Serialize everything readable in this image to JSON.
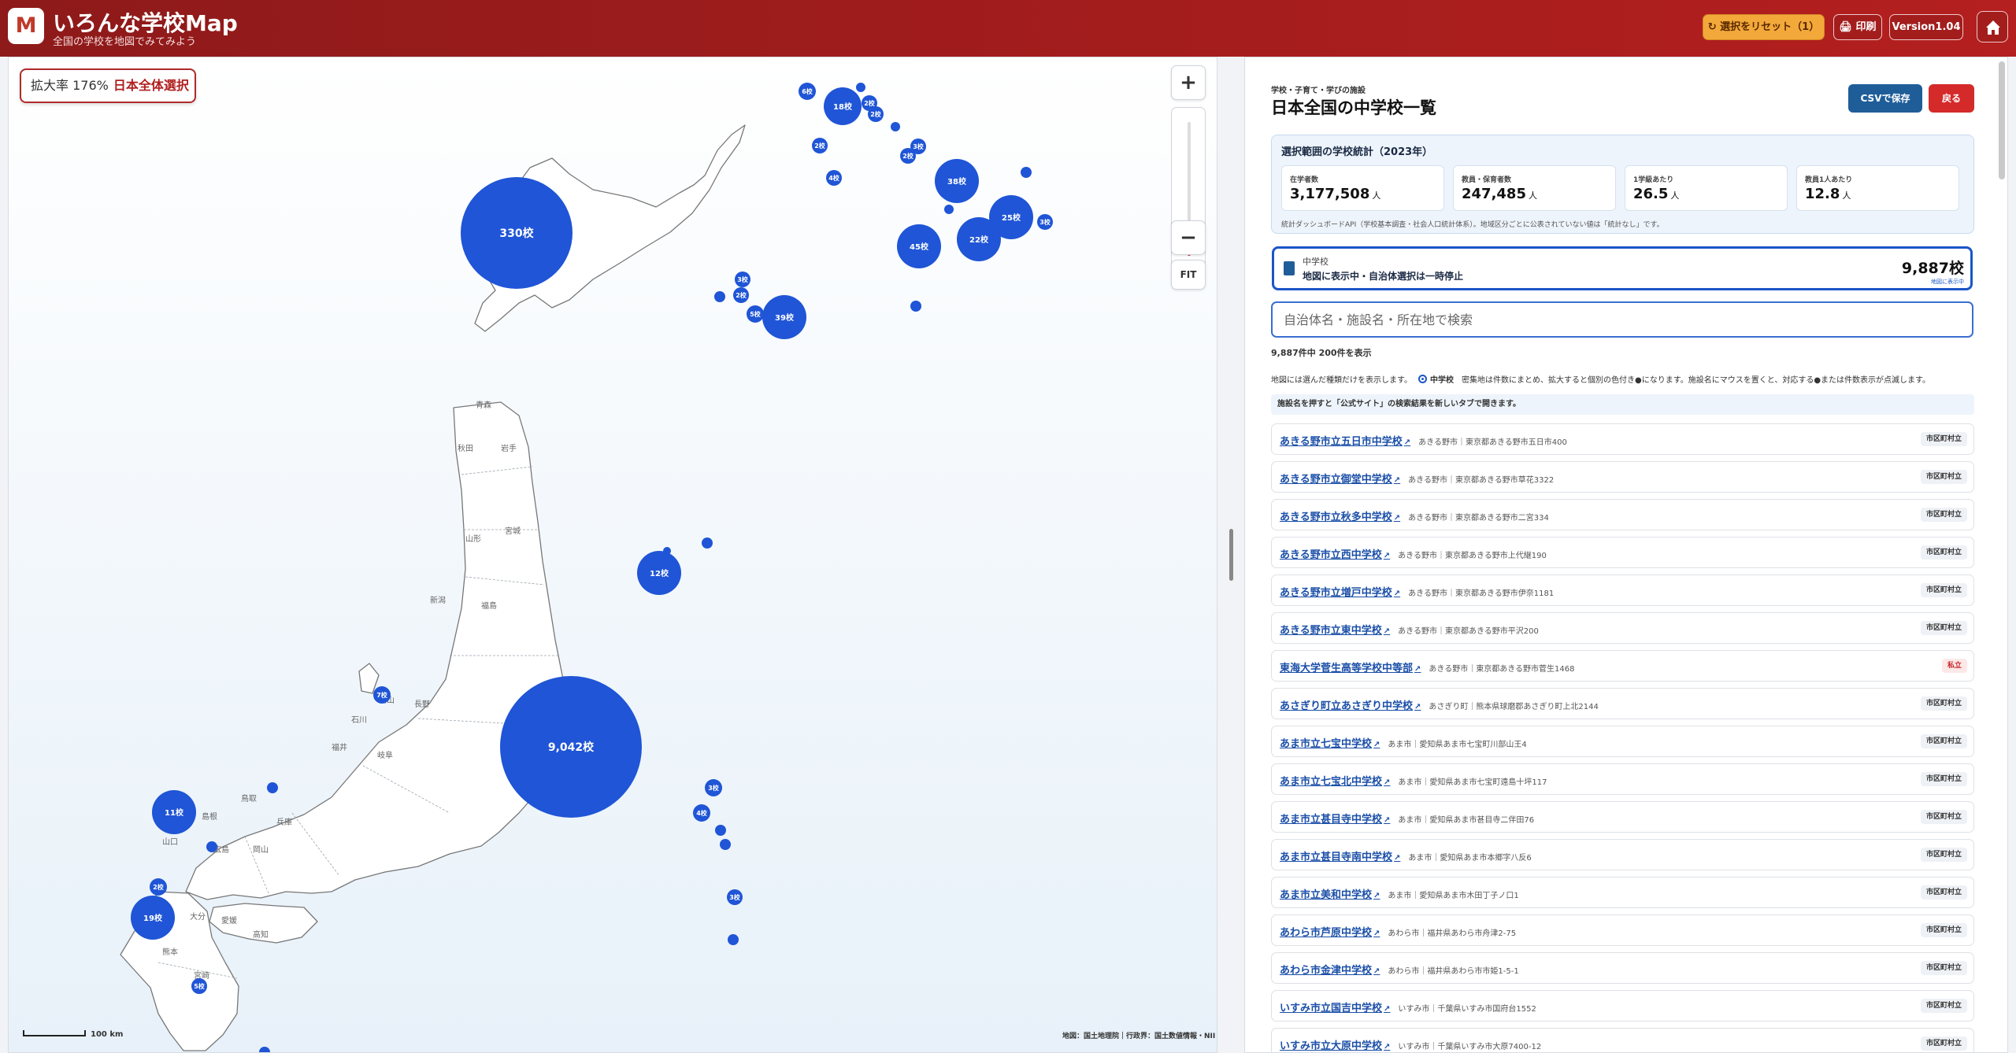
{
  "header": {
    "logo_letter": "M",
    "title": "いろんな学校Map",
    "subtitle": "全国の学校を地図でみてみよう",
    "reset_label": "↻ 選択をリセット（1）",
    "print_label": "🖨 印刷",
    "version_label": "Version1.04",
    "home_icon": "home-icon"
  },
  "map": {
    "zoom_label": "拡大率 176%",
    "selection_label": "日本全体選択",
    "zoom_in": "+",
    "zoom_out": "−",
    "fit_label": "FIT",
    "zoom_level_fraction": 0.2,
    "scale_label": "100 km",
    "attribution": "地図：国土地理院｜行政界：国土数値情報・NII",
    "bubbles": [
      "330校",
      "9,042校",
      "39校",
      "38校",
      "25校",
      "22校",
      "45校",
      "18校",
      "12校",
      "11校",
      "19校",
      "7校",
      "6校",
      "5校",
      "4校",
      "3校",
      "2校"
    ],
    "prefecture_labels": [
      "青森",
      "秋田",
      "岩手",
      "山形",
      "宮城",
      "新潟",
      "福島",
      "長野",
      "石川",
      "富山",
      "福井",
      "岐阜",
      "山口",
      "鳥取",
      "島根",
      "兵庫",
      "大分",
      "熊本",
      "宮崎",
      "広島",
      "岡山",
      "愛媛",
      "高知"
    ]
  },
  "panel": {
    "kicker": "学校・子育て・学びの施設",
    "title": "日本全国の中学校一覧",
    "csv_label": "CSVで保存",
    "back_label": "戻る",
    "stats": {
      "title": "選択範囲の学校統計（2023年）",
      "cards": [
        {
          "label": "在学者数",
          "value": "3,177,508",
          "unit": "人"
        },
        {
          "label": "教員・保育者数",
          "value": "247,485",
          "unit": "人"
        },
        {
          "label": "1学級あたり",
          "value": "26.5",
          "unit": "人"
        },
        {
          "label": "教員1人あたり",
          "value": "12.8",
          "unit": "人"
        }
      ],
      "note": "統計ダッシュボードAPI（学校基本調査・社会人口統計体系）。地域区分ごとに公表されていない値は「統計なし」です。"
    },
    "type_card": {
      "name": "中学校",
      "status": "地図に表示中・自治体選択は一時停止",
      "count": "9,887校",
      "sub": "地図に表示中"
    },
    "search_placeholder": "自治体名・施設名・所在地で検索",
    "count_text": "9,887件中 200件を表示",
    "map_note_prefix": "地図には選んだ種類だけを表示します。",
    "map_note_radio": "中学校",
    "map_note_suffix": "密集地は件数にまとめ、拡大すると個別の色付き●になります。施設名にマウスを置くと、対応する●または件数表示が点滅します。",
    "link_note": "施設名を押すと「公式サイト」の検索結果を新しいタブで開きます。",
    "schools": [
      {
        "name": "あきる野市立五日市中学校",
        "address": "あきる野市｜東京都あきる野市五日市400",
        "type": "市区町村立"
      },
      {
        "name": "あきる野市立御堂中学校",
        "address": "あきる野市｜東京都あきる野市草花3322",
        "type": "市区町村立"
      },
      {
        "name": "あきる野市立秋多中学校",
        "address": "あきる野市｜東京都あきる野市二宮334",
        "type": "市区町村立"
      },
      {
        "name": "あきる野市立西中学校",
        "address": "あきる野市｜東京都あきる野市上代継190",
        "type": "市区町村立"
      },
      {
        "name": "あきる野市立増戸中学校",
        "address": "あきる野市｜東京都あきる野市伊奈1181",
        "type": "市区町村立"
      },
      {
        "name": "あきる野市立東中学校",
        "address": "あきる野市｜東京都あきる野市平沢200",
        "type": "市区町村立"
      },
      {
        "name": "東海大学菅生高等学校中等部",
        "address": "あきる野市｜東京都あきる野市菅生1468",
        "type": "私立"
      },
      {
        "name": "あさぎり町立あさぎり中学校",
        "address": "あさぎり町｜熊本県球磨郡あさぎり町上北2144",
        "type": "市区町村立"
      },
      {
        "name": "あま市立七宝中学校",
        "address": "あま市｜愛知県あま市七宝町川部山王4",
        "type": "市区町村立"
      },
      {
        "name": "あま市立七宝北中学校",
        "address": "あま市｜愛知県あま市七宝町遠島十坪117",
        "type": "市区町村立"
      },
      {
        "name": "あま市立甚目寺中学校",
        "address": "あま市｜愛知県あま市甚目寺二伴田76",
        "type": "市区町村立"
      },
      {
        "name": "あま市立甚目寺南中学校",
        "address": "あま市｜愛知県あま市本郷字八反6",
        "type": "市区町村立"
      },
      {
        "name": "あま市立美和中学校",
        "address": "あま市｜愛知県あま市木田丁子ノ口1",
        "type": "市区町村立"
      },
      {
        "name": "あわら市芦原中学校",
        "address": "あわら市｜福井県あわら市舟津2-75",
        "type": "市区町村立"
      },
      {
        "name": "あわら市金津中学校",
        "address": "あわら市｜福井県あわら市市姫1-5-1",
        "type": "市区町村立"
      },
      {
        "name": "いすみ市立国吉中学校",
        "address": "いすみ市｜千葉県いすみ市国府台1552",
        "type": "市区町村立"
      },
      {
        "name": "いすみ市立大原中学校",
        "address": "いすみ市｜千葉県いすみ市大原7400-12",
        "type": "市区町村立"
      }
    ]
  }
}
